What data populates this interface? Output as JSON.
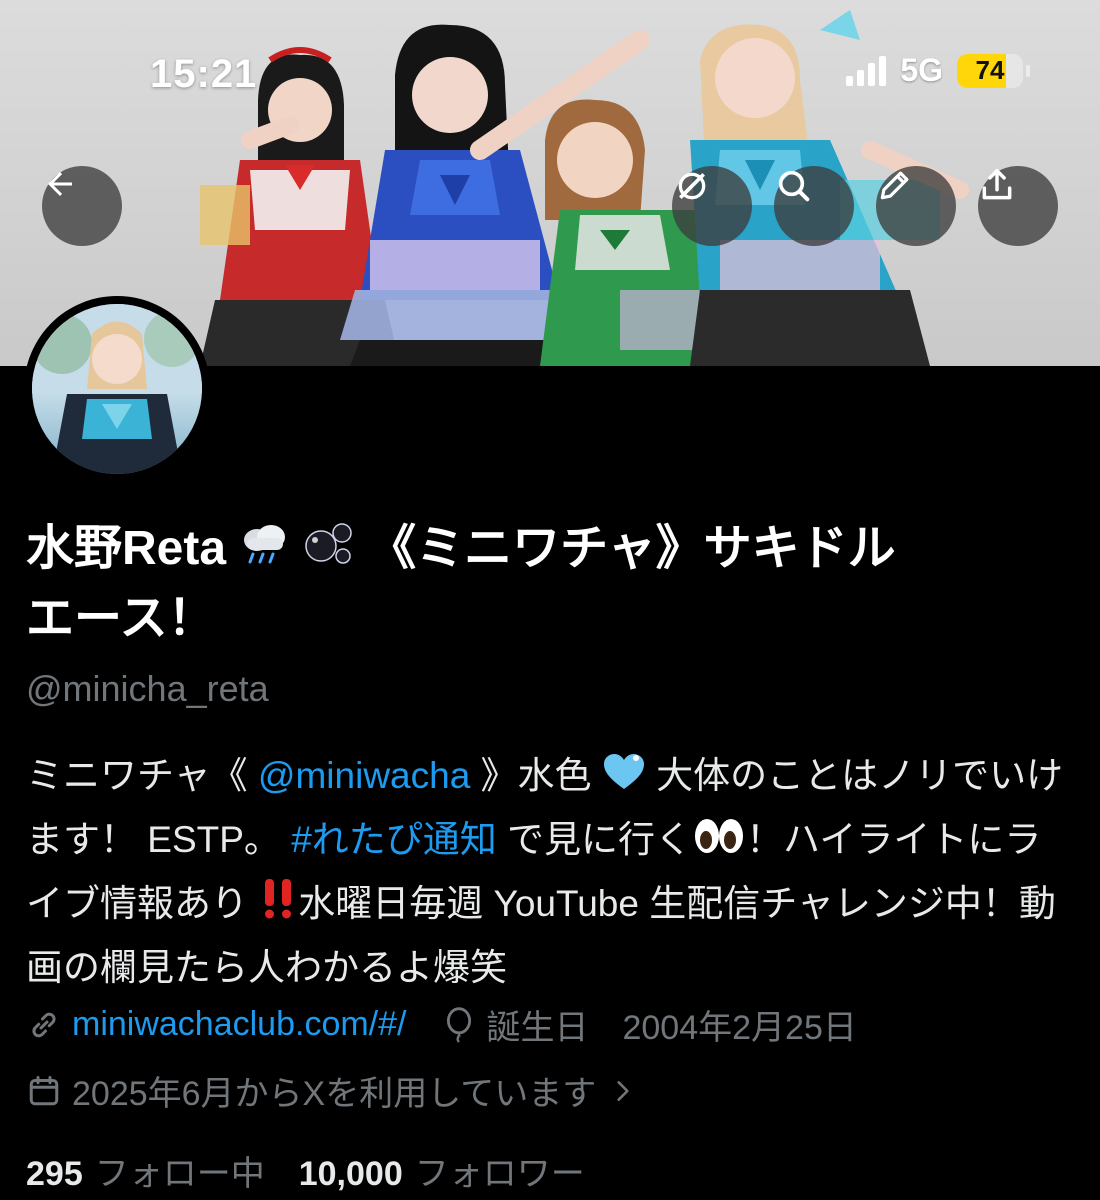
{
  "status_bar": {
    "time": "15:21",
    "network": "5G",
    "battery_percent": 74,
    "battery_label": "74",
    "signal_bars": 4,
    "battery_color": "#ffd60a"
  },
  "header_buttons": {
    "back": "arrow-left-icon",
    "grok": "grok-icon",
    "search": "search-icon",
    "edit": "pencil-icon",
    "share": "share-icon"
  },
  "profile": {
    "display_name_part1": "水野Reta",
    "display_name_part2": "《ミニワチャ》サキドル",
    "display_name_part3": "エース！",
    "handle": "@minicha_reta",
    "bio": {
      "t1": "ミニワチャ《 ",
      "mention": "@miniwacha",
      "t2": " 》水色",
      "t3": " 大体のことはノリでいけます！ ESTP。 ",
      "hashtag": "#れたぴ通知",
      "t4": " で見に行く",
      "t5": "！ハイライトにライブ情報あり",
      "t6": "水曜日毎週 YouTube 生配信チャレンジ中！動画の欄見たら人わかるよ爆笑"
    },
    "website": "miniwachaclub.com/#/",
    "birthday": "誕生日　2004年2月25日",
    "joined": "2025年6月からXを利用しています",
    "following_count": "295",
    "following_label": "フォロー中",
    "followers_count": "10,000",
    "followers_label": "フォロワー"
  },
  "colors": {
    "accent": "#1d9bf0",
    "secondary_text": "#71767b",
    "primary_text": "#e7e9ea",
    "background": "#000000"
  }
}
